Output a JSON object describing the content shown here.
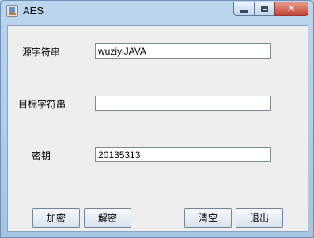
{
  "window": {
    "title": "AES",
    "controls": {
      "minimize": "minimize-icon",
      "maximize": "maximize-icon",
      "close": "close-icon"
    }
  },
  "form": {
    "source": {
      "label": "源字符串",
      "value": "wuziyiJAVA"
    },
    "target": {
      "label": "目标字符串",
      "value": ""
    },
    "key": {
      "label": "密钥",
      "value": "20135313"
    }
  },
  "buttons": {
    "encrypt": "加密",
    "decrypt": "解密",
    "clear": "清空",
    "exit": "退出"
  }
}
